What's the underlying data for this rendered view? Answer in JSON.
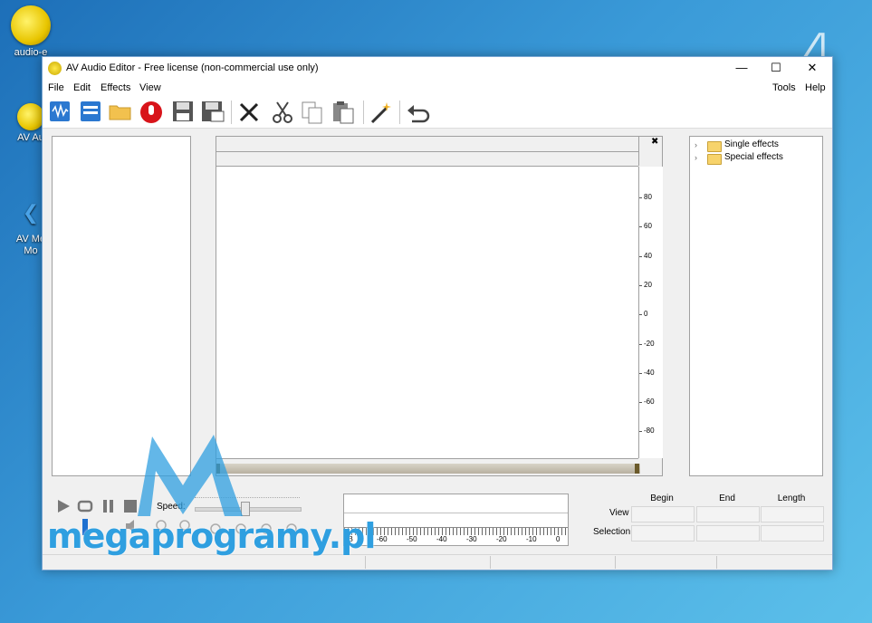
{
  "desktop": {
    "icons": [
      {
        "label": "audio-e",
        "icon": "audio-editor-shortcut-icon"
      },
      {
        "label": "AV Au",
        "icon": "av-audio-shortcut-icon"
      },
      {
        "label": "AV Me\nMo",
        "icon": "av-media-shortcut-icon"
      }
    ],
    "corner_number": "4"
  },
  "window": {
    "title": "AV Audio Editor - Free license (non-commercial use only)",
    "controls": {
      "minimize": "—",
      "maximize": "☐",
      "close": "✕"
    }
  },
  "menu": {
    "left": [
      "File",
      "Edit",
      "Effects",
      "View"
    ],
    "right": [
      "Tools",
      "Help"
    ]
  },
  "toolbar": {
    "buttons": [
      "new-wave-icon",
      "new-document-icon",
      "open-folder-icon",
      "record-icon",
      "save-icon",
      "save-as-icon",
      "delete-icon",
      "cut-icon",
      "copy-icon",
      "paste-icon",
      "effects-wand-icon",
      "undo-icon"
    ]
  },
  "waveform": {
    "close": "✖",
    "y_ticks": [
      "80",
      "60",
      "40",
      "20",
      "0",
      "-20",
      "-40",
      "-60",
      "-80"
    ]
  },
  "effects_tree": {
    "items": [
      "Single effects",
      "Special effects"
    ]
  },
  "transport": {
    "speed_label": "Speed:"
  },
  "level_meter": {
    "labels": [
      "dB",
      "-60",
      "-50",
      "-40",
      "-30",
      "-20",
      "-10",
      "0"
    ]
  },
  "selection_info": {
    "columns": [
      "Begin",
      "End",
      "Length"
    ],
    "rows": [
      "View",
      "Selection"
    ]
  },
  "watermark": {
    "text": "megaprogramy.pl"
  },
  "colors": {
    "accent": "#2f9fe0",
    "desktop": "#3a9ad8"
  }
}
